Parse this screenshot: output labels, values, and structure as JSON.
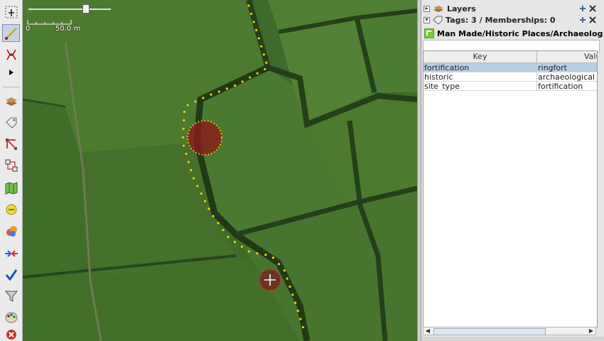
{
  "toolbar": {
    "tools": [
      {
        "icon": "select-icon"
      },
      {
        "icon": "draw-way-icon"
      },
      {
        "icon": "split-icon"
      },
      {
        "icon": "expand-arrow-icon"
      },
      {
        "icon": "layers-icon"
      },
      {
        "icon": "tags-icon"
      },
      {
        "icon": "selection-icon"
      },
      {
        "icon": "relation-icon"
      },
      {
        "icon": "map-icon"
      },
      {
        "icon": "commands-icon"
      },
      {
        "icon": "conflict-icon"
      },
      {
        "icon": "merge-icon"
      },
      {
        "icon": "validator-icon"
      },
      {
        "icon": "filter-icon"
      },
      {
        "icon": "style-icon"
      },
      {
        "icon": "close-icon"
      }
    ]
  },
  "map": {
    "scale_zero": "0",
    "scale_label": "50.0 m",
    "zoom_level": 0.72
  },
  "layers_panel": {
    "title": "Layers"
  },
  "tags_panel": {
    "title": "Tags: 3 / Memberships: 0",
    "preset": "Man Made/Historic Places/Archaeolog",
    "search_value": "",
    "columns": [
      "Key",
      "Valu"
    ],
    "rows": [
      {
        "key": "fortification",
        "value": "ringfort",
        "selected": true
      },
      {
        "key": "historic",
        "value": "archaeological_s",
        "selected": false
      },
      {
        "key": "site_type",
        "value": "fortification",
        "selected": false
      }
    ]
  },
  "colors": {
    "selection": "#b8cfe5",
    "node": "#f7d300",
    "area_fill": "#8b1a1a"
  }
}
